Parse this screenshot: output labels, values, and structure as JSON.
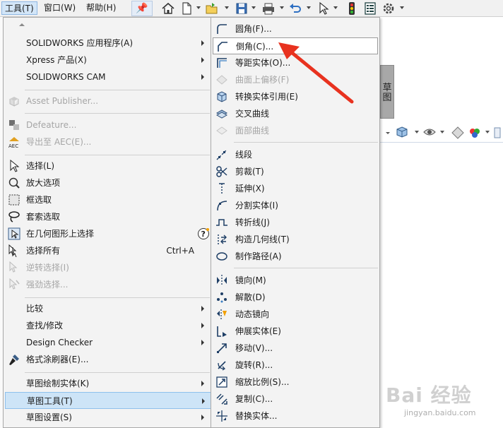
{
  "menubar": {
    "tools": "工具(T)",
    "window": "窗口(W)",
    "help": "帮助(H)"
  },
  "background": {
    "side_label": "草\n图"
  },
  "tools_menu": {
    "items": [
      {
        "label": "SOLIDWORKS 应用程序(A)",
        "submenu": true
      },
      {
        "label": "Xpress 产品(X)",
        "submenu": true
      },
      {
        "label": "SOLIDWORKS CAM",
        "submenu": true
      },
      {
        "label": "Asset Publisher...",
        "disabled": true,
        "icon": "asset-publisher-icon"
      },
      {
        "label": "Defeature...",
        "disabled": true,
        "icon": "defeature-icon"
      },
      {
        "label": "导出至 AEC(E)...",
        "disabled": true,
        "icon": "aec-icon"
      },
      {
        "label": "选择(L)",
        "icon": "select-arrow-icon"
      },
      {
        "label": "放大选项",
        "icon": "magnify-select-icon"
      },
      {
        "label": "框选取",
        "icon": "box-select-icon"
      },
      {
        "label": "套索选取",
        "icon": "lasso-select-icon"
      },
      {
        "label": "在几何图形上选择",
        "icon": "select-over-geometry-icon",
        "help_icon": true
      },
      {
        "label": "选择所有",
        "shortcut": "Ctrl+A",
        "icon": "select-all-icon"
      },
      {
        "label": "逆转选择(I)",
        "disabled": true,
        "icon": "invert-select-icon"
      },
      {
        "label": "强劲选择...",
        "disabled": true,
        "icon": "power-select-icon"
      },
      {
        "label": "比较",
        "submenu": true
      },
      {
        "label": "查找/修改",
        "submenu": true
      },
      {
        "label": "Design Checker",
        "submenu": true
      },
      {
        "label": "格式涂刷器(E)...",
        "icon": "format-painter-icon"
      },
      {
        "label": "草图绘制实体(K)",
        "submenu": true
      },
      {
        "label": "草图工具(T)",
        "submenu": true,
        "highlight": true
      },
      {
        "label": "草图设置(S)",
        "submenu": true
      }
    ]
  },
  "sketch_tools_menu": {
    "items": [
      {
        "label": "圆角(F)...",
        "icon": "fillet-icon"
      },
      {
        "label": "倒角(C)...",
        "icon": "chamfer-icon",
        "highlight": true
      },
      {
        "label": "等距实体(O)...",
        "icon": "offset-entities-icon"
      },
      {
        "label": "曲面上偏移(F)",
        "icon": "offset-on-surface-icon",
        "disabled": true
      },
      {
        "label": "转换实体引用(E)",
        "icon": "convert-entities-icon"
      },
      {
        "label": "交叉曲线",
        "icon": "intersection-curve-icon"
      },
      {
        "label": "面部曲线",
        "icon": "face-curves-icon",
        "disabled": true
      },
      {
        "label": "线段",
        "icon": "segment-icon"
      },
      {
        "label": "剪裁(T)",
        "icon": "trim-icon"
      },
      {
        "label": "延伸(X)",
        "icon": "extend-icon"
      },
      {
        "label": "分割实体(I)",
        "icon": "split-entities-icon"
      },
      {
        "label": "转折线(J)",
        "icon": "jog-line-icon"
      },
      {
        "label": "构造几何线(T)",
        "icon": "construction-geometry-icon"
      },
      {
        "label": "制作路径(A)",
        "icon": "make-path-icon"
      },
      {
        "label": "镜向(M)",
        "icon": "mirror-icon"
      },
      {
        "label": "解散(D)",
        "icon": "dissolve-icon"
      },
      {
        "label": "动态镜向",
        "icon": "dynamic-mirror-icon"
      },
      {
        "label": "伸展实体(E)",
        "icon": "stretch-entities-icon"
      },
      {
        "label": "移动(V)...",
        "icon": "move-icon"
      },
      {
        "label": "旋转(R)...",
        "icon": "rotate-icon"
      },
      {
        "label": "缩放比例(S)...",
        "icon": "scale-icon"
      },
      {
        "label": "复制(C)...",
        "icon": "copy-icon"
      },
      {
        "label": "替换实体...",
        "icon": "replace-entity-icon"
      }
    ]
  },
  "watermark": {
    "main": "Bai 经验",
    "sub": "jingyan.baidu.com"
  },
  "colors": {
    "menu_bg": "#f3f3f3",
    "highlight": "#cde4f7",
    "annotation_red": "#e8321f"
  }
}
